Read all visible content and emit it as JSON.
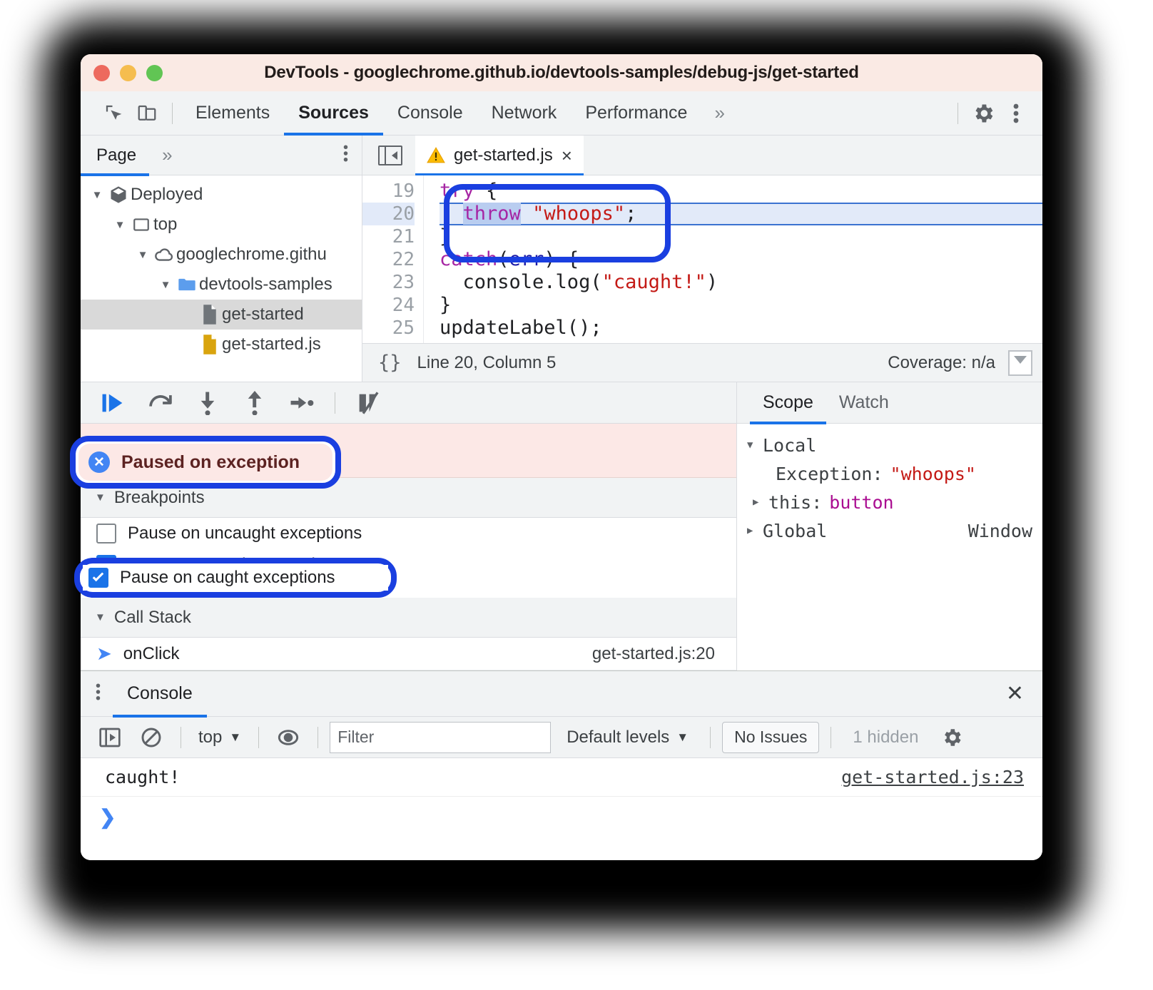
{
  "window": {
    "title": "DevTools - googlechrome.github.io/devtools-samples/debug-js/get-started",
    "traffic": {
      "close": "close",
      "minimize": "minimize",
      "zoom": "zoom"
    }
  },
  "main_tabs": {
    "inspect_icon": "inspect-cursor-icon",
    "device_icon": "device-toolbar-icon",
    "items": [
      {
        "label": "Elements",
        "active": false
      },
      {
        "label": "Sources",
        "active": true
      },
      {
        "label": "Console",
        "active": false
      },
      {
        "label": "Network",
        "active": false
      },
      {
        "label": "Performance",
        "active": false
      }
    ],
    "overflow": "»",
    "settings_icon": "gear-icon",
    "more_icon": "kebab-menu-icon"
  },
  "navigator": {
    "tab_label": "Page",
    "overflow": "»",
    "more_icon": "kebab-menu-icon",
    "tree": [
      {
        "label": "Deployed",
        "icon": "cube-icon",
        "indent": 0,
        "expanded": true,
        "selected": false
      },
      {
        "label": "top",
        "icon": "frame-icon",
        "indent": 1,
        "expanded": true,
        "selected": false
      },
      {
        "label": "googlechrome.githu",
        "icon": "cloud-icon",
        "indent": 2,
        "expanded": true,
        "selected": false
      },
      {
        "label": "devtools-samples",
        "icon": "folder-icon",
        "indent": 3,
        "expanded": true,
        "selected": false
      },
      {
        "label": "get-started",
        "icon": "document-gray-icon",
        "indent": 4,
        "expanded": null,
        "selected": true
      },
      {
        "label": "get-started.js",
        "icon": "document-yellow-icon",
        "indent": 4,
        "expanded": null,
        "selected": false
      }
    ]
  },
  "editor": {
    "panel_toggle_icon": "show-navigator-icon",
    "tab": {
      "warning_icon": "warning-triangle-icon",
      "filename": "get-started.js",
      "close": "×"
    },
    "lines": [
      {
        "num": "19",
        "tokens": [
          {
            "t": "try",
            "c": "kw"
          },
          {
            "t": " {",
            "c": ""
          }
        ],
        "highlight": false
      },
      {
        "num": "20",
        "tokens": [
          {
            "t": "  ",
            "c": ""
          },
          {
            "t": "throw",
            "c": "kw sel"
          },
          {
            "t": " ",
            "c": ""
          },
          {
            "t": "\"whoops\"",
            "c": "str"
          },
          {
            "t": ";",
            "c": ""
          }
        ],
        "highlight": true
      },
      {
        "num": "21",
        "tokens": [
          {
            "t": "}",
            "c": ""
          }
        ],
        "highlight": false
      },
      {
        "num": "22",
        "tokens": [
          {
            "t": "catch",
            "c": "kw"
          },
          {
            "t": "(",
            "c": ""
          },
          {
            "t": "err",
            "c": "var"
          },
          {
            "t": ") {",
            "c": ""
          }
        ],
        "highlight": false
      },
      {
        "num": "23",
        "tokens": [
          {
            "t": "  console.log(",
            "c": ""
          },
          {
            "t": "\"caught!\"",
            "c": "str"
          },
          {
            "t": ")",
            "c": ""
          }
        ],
        "highlight": false
      },
      {
        "num": "24",
        "tokens": [
          {
            "t": "}",
            "c": ""
          }
        ],
        "highlight": false
      },
      {
        "num": "25",
        "tokens": [
          {
            "t": "updateLabel();",
            "c": ""
          }
        ],
        "highlight": false
      }
    ],
    "status": {
      "format_icon": "{}",
      "position": "Line 20, Column 5",
      "coverage": "Coverage: n/a",
      "dropdown_icon": "chevron-down-boxed-icon"
    }
  },
  "debugger": {
    "toolbar": [
      {
        "name": "resume-script-execution",
        "icon": "resume-icon"
      },
      {
        "name": "step-over-next-call",
        "icon": "step-over-icon"
      },
      {
        "name": "step-into-next-call",
        "icon": "step-into-icon"
      },
      {
        "name": "step-out-of-current-function",
        "icon": "step-out-icon"
      },
      {
        "name": "step",
        "icon": "step-icon"
      },
      {
        "name": "deactivate-breakpoints",
        "icon": "deactivate-breakpoints-icon"
      }
    ],
    "paused": {
      "icon": "pause-exception-icon",
      "text": "Paused on exception"
    },
    "breakpoints": {
      "section_label": "Breakpoints",
      "options": [
        {
          "label": "Pause on uncaught exceptions",
          "checked": false
        },
        {
          "label": "Pause on caught exceptions",
          "checked": true
        }
      ]
    },
    "call_stack": {
      "section_label": "Call Stack",
      "frames": [
        {
          "name": "onClick",
          "location": "get-started.js:20",
          "active": true
        }
      ]
    }
  },
  "scope": {
    "tabs": [
      {
        "label": "Scope",
        "active": true
      },
      {
        "label": "Watch",
        "active": false
      }
    ],
    "rows": [
      {
        "indent": 0,
        "tri": "▼",
        "key": "Local",
        "value": "",
        "value_class": "",
        "right": ""
      },
      {
        "indent": 1,
        "tri": "",
        "key": "Exception:",
        "value": "\"whoops\"",
        "value_class": "str-red",
        "right": ""
      },
      {
        "indent": 0,
        "tri": "▶",
        "key": "this:",
        "value": "button",
        "value_class": "magenta",
        "right": ""
      },
      {
        "indent": 0,
        "tri": "▶",
        "key": "Global",
        "value": "",
        "value_class": "",
        "right": "Window"
      }
    ]
  },
  "drawer": {
    "more_icon": "kebab-menu-icon",
    "tab_label": "Console",
    "close_icon": "close-icon",
    "toolbar": {
      "sidebar_icon": "console-sidebar-icon",
      "clear_icon": "clear-console-icon",
      "context": "top",
      "context_caret": "▼",
      "eye_icon": "live-expression-icon",
      "filter_placeholder": "Filter",
      "filter_value": "",
      "levels_label": "Default levels",
      "levels_caret": "▼",
      "issues_label": "No Issues",
      "hidden_count": "1 hidden",
      "settings_icon": "gear-icon"
    },
    "messages": [
      {
        "text": "caught!",
        "source": "get-started.js:23"
      }
    ],
    "prompt_caret": "❯"
  },
  "annotations": {
    "rings": [
      {
        "name": "code-throw-highlight-ring"
      },
      {
        "name": "paused-on-exception-ring"
      },
      {
        "name": "pause-on-caught-exceptions-ring"
      }
    ]
  },
  "colors": {
    "accent": "#1a73e8",
    "annotation": "#1a3fe0",
    "paused_bg": "#fce8e6",
    "paused_text": "#5c2221",
    "titlebar_bg": "#faeae4",
    "toolbar_bg": "#f1f3f4",
    "string": "#c41a16",
    "keyword": "#a626a4"
  }
}
